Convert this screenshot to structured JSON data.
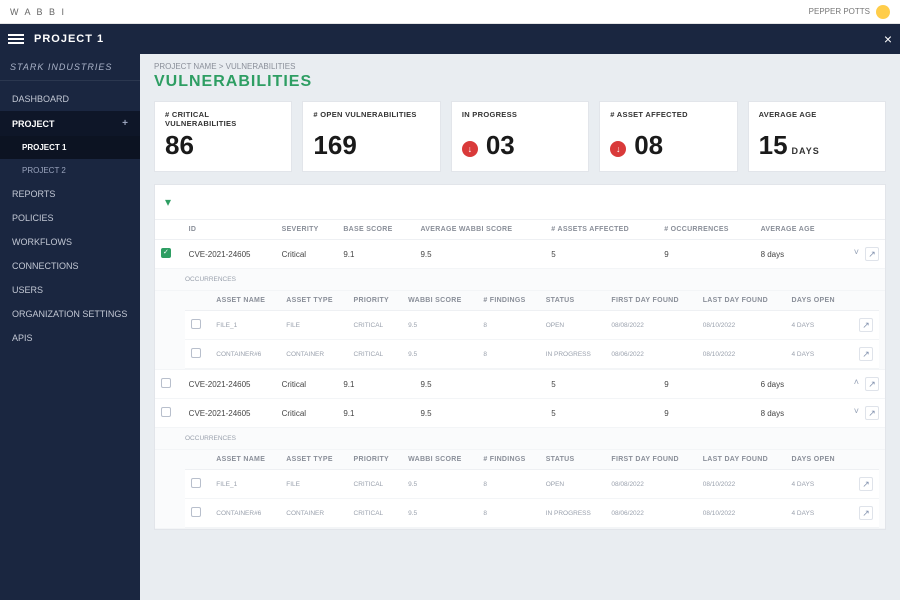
{
  "topbar": {
    "brand": "W A B B I",
    "user": "PEPPER POTTS"
  },
  "titlebar": {
    "title": "PROJECT 1",
    "close": "×"
  },
  "sidebar": {
    "brand": "STARK INDUSTRIES",
    "items": [
      {
        "label": "DASHBOARD"
      },
      {
        "label": "PROJECT",
        "plus": "+",
        "active": true
      },
      {
        "label": "PROJECT 1",
        "sub": true,
        "active": true
      },
      {
        "label": "PROJECT 2",
        "sub": true
      },
      {
        "label": "REPORTS"
      },
      {
        "label": "POLICIES"
      },
      {
        "label": "WORKFLOWS"
      },
      {
        "label": "CONNECTIONS"
      },
      {
        "label": "USERS"
      },
      {
        "label": "ORGANIZATION SETTINGS"
      },
      {
        "label": "APIS"
      }
    ]
  },
  "breadcrumb": "PROJECT NAME > VULNERABILITIES",
  "page_title": "VULNERABILITIES",
  "cards": [
    {
      "label": "# CRITICAL VULNERABILITIES",
      "value": "86"
    },
    {
      "label": "# OPEN VULNERABILITIES",
      "value": "169"
    },
    {
      "label": "IN PROGRESS",
      "value": "03",
      "dot": "↓"
    },
    {
      "label": "# ASSET AFFECTED",
      "value": "08",
      "dot": "↓"
    },
    {
      "label": "AVERAGE AGE",
      "value": "15",
      "unit": "DAYS"
    }
  ],
  "table": {
    "columns": [
      "",
      "ID",
      "SEVERITY",
      "BASE SCORE",
      "AVERAGE WABBI SCORE",
      "# ASSETS AFFECTED",
      "# OCCURRENCES",
      "AVERAGE AGE",
      ""
    ],
    "sub_label": "OCCURRENCES",
    "sub_columns": [
      "",
      "ASSET NAME",
      "ASSET TYPE",
      "PRIORITY",
      "WABBI SCORE",
      "# FINDINGS",
      "STATUS",
      "FIRST DAY FOUND",
      "LAST DAY FOUND",
      "DAYS OPEN",
      ""
    ],
    "rows": [
      {
        "checked": true,
        "id": "CVE-2021-24605",
        "severity": "Critical",
        "base": "9.1",
        "avg_wabbi": "9.5",
        "assets": "5",
        "occurrences": "9",
        "age": "8 days",
        "expanded": true,
        "sub": [
          {
            "asset": "file_1",
            "type": "File",
            "priority": "Critical",
            "score": "9.5",
            "findings": "8",
            "status": "OPEN",
            "first": "08/08/2022",
            "last": "08/10/2022",
            "open": "4 days"
          },
          {
            "asset": "container#6",
            "type": "Container",
            "priority": "Critical",
            "score": "9.5",
            "findings": "8",
            "status": "IN PROGRESS",
            "first": "08/06/2022",
            "last": "08/10/2022",
            "open": "4 days"
          }
        ]
      },
      {
        "checked": false,
        "id": "CVE-2021-24605",
        "severity": "Critical",
        "base": "9.1",
        "avg_wabbi": "9.5",
        "assets": "5",
        "occurrences": "9",
        "age": "6 days",
        "expanded": false
      },
      {
        "checked": false,
        "id": "CVE-2021-24605",
        "severity": "Critical",
        "base": "9.1",
        "avg_wabbi": "9.5",
        "assets": "5",
        "occurrences": "9",
        "age": "8 days",
        "expanded": true,
        "sub": [
          {
            "asset": "file_1",
            "type": "File",
            "priority": "Critical",
            "score": "9.5",
            "findings": "8",
            "status": "OPEN",
            "first": "08/08/2022",
            "last": "08/10/2022",
            "open": "4 days"
          },
          {
            "asset": "container#6",
            "type": "Container",
            "priority": "Critical",
            "score": "9.5",
            "findings": "8",
            "status": "IN PROGRESS",
            "first": "08/06/2022",
            "last": "08/10/2022",
            "open": "4 days"
          }
        ]
      }
    ]
  }
}
